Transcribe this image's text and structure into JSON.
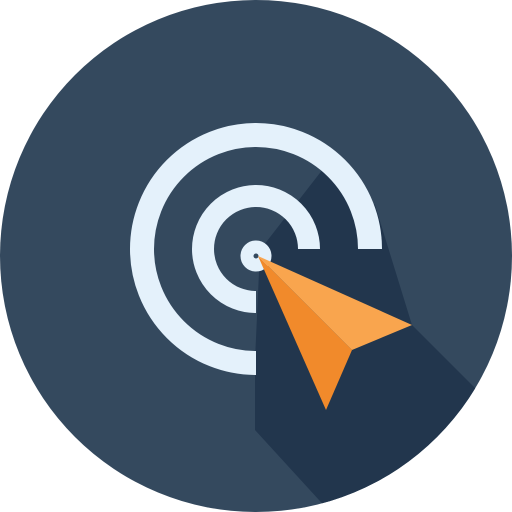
{
  "icon": {
    "name": "click-target-cursor-icon",
    "colors": {
      "circle_background": "#34495E",
      "long_shadow": "#22364D",
      "rings": "#E4F1FB",
      "cursor_dark": "#F18A2B",
      "cursor_light": "#F9A54E"
    }
  }
}
